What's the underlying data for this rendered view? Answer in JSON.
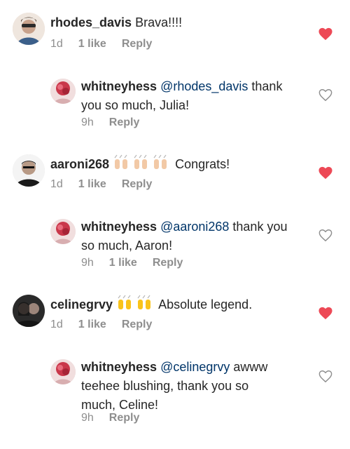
{
  "comments": [
    {
      "username": "rhodes_davis",
      "text": " Brava!!!!",
      "time": "1d",
      "likes": "1 like",
      "reply": "Reply",
      "liked": true
    },
    {
      "username": "whitneyhess",
      "mention": "@rhodes_davis",
      "text_line1_rest": " thank",
      "text_line2": "you so much, Julia!",
      "time": "9h",
      "reply": "Reply",
      "liked": false
    },
    {
      "username": "aaroni268",
      "emoji": "raising-hands-light",
      "text": "Congrats!",
      "time": "1d",
      "likes": "1 like",
      "reply": "Reply",
      "liked": true
    },
    {
      "username": "whitneyhess",
      "mention": "@aaroni268",
      "text_line1_rest": " thank you",
      "text_line2": "so much, Aaron!",
      "time": "9h",
      "likes": "1 like",
      "reply": "Reply",
      "liked": false
    },
    {
      "username": "celinegrvy",
      "emoji": "raising-hands-yellow",
      "text": "Absolute legend.",
      "time": "1d",
      "likes": "1 like",
      "reply": "Reply",
      "liked": true
    },
    {
      "username": "whitneyhess",
      "mention": "@celinegrvy",
      "text_line1_rest": " awww",
      "text_line2": "teehee blushing, thank you so",
      "text_line3": "much, Celine!",
      "time": "9h",
      "reply": "Reply",
      "liked": false
    }
  ],
  "colors": {
    "heart_liked": "#ed4956",
    "heart_outline": "#8e8e8e",
    "mention": "#003569",
    "meta": "#8e8e8e",
    "emoji_light": "#f2c9a6",
    "emoji_yellow": "#f9c31a"
  }
}
